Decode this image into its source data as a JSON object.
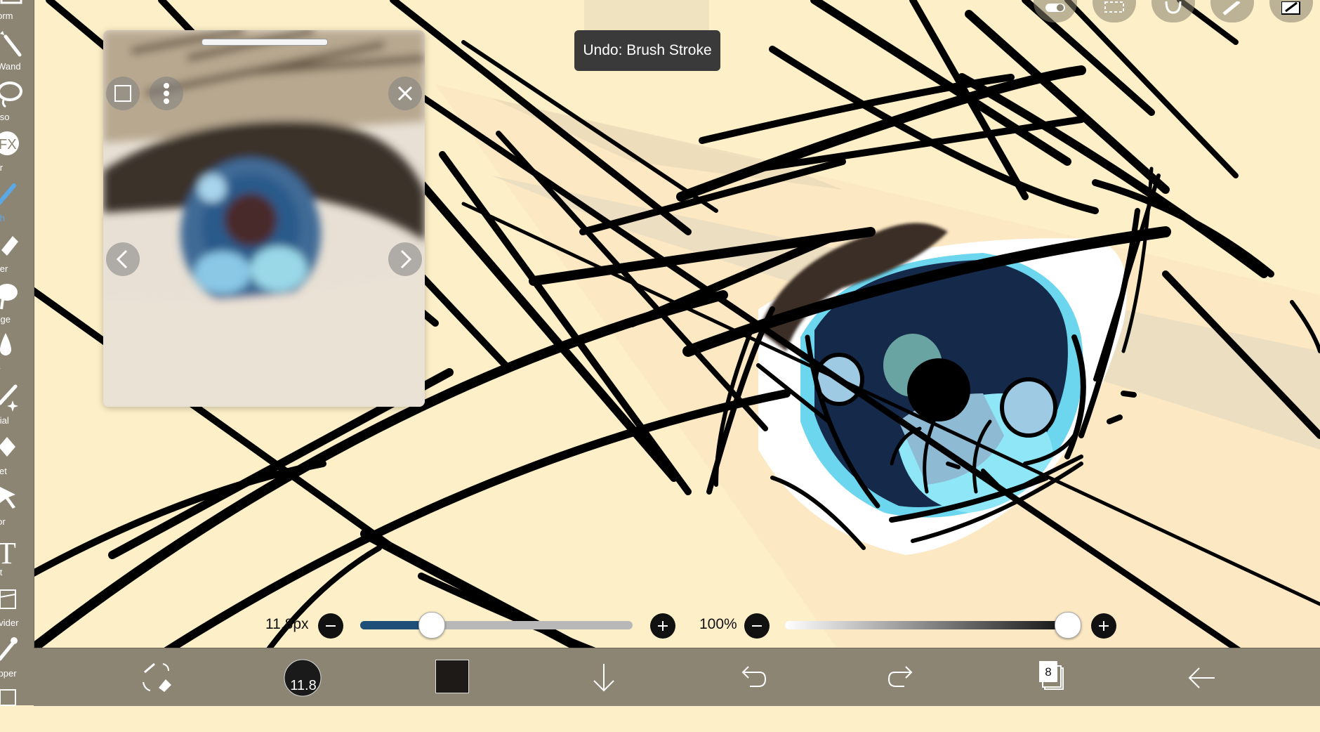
{
  "colors": {
    "toolbar": "#8c8574",
    "accent": "#5aa9e6",
    "canvas": "#fdf0c8",
    "current_color": "#1e1a18"
  },
  "left_toolbar": {
    "items": [
      {
        "label": "sform",
        "icon": "transform-icon",
        "active": false
      },
      {
        "label": "c Wand",
        "icon": "magic-wand-icon",
        "active": false
      },
      {
        "label": "asso",
        "icon": "lasso-icon",
        "active": false
      },
      {
        "label": "lter",
        "icon": "filter-fx-icon",
        "active": false
      },
      {
        "label": "ush",
        "icon": "brush-icon",
        "active": true
      },
      {
        "label": "aser",
        "icon": "eraser-icon",
        "active": false
      },
      {
        "label": "udge",
        "icon": "smudge-icon",
        "active": false
      },
      {
        "label": "lur",
        "icon": "blur-drop-icon",
        "active": false
      },
      {
        "label": "ecial",
        "icon": "special-pen-icon",
        "active": false
      },
      {
        "label": "cket",
        "icon": "bucket-icon",
        "active": false
      },
      {
        "label": "ctor",
        "icon": "vector-pointer-icon",
        "active": false
      },
      {
        "label": "ext",
        "icon": "text-icon",
        "active": false
      },
      {
        "label": " Divider",
        "icon": "frame-divider-icon",
        "active": false
      },
      {
        "label": "ropper",
        "icon": "eyedropper-icon",
        "active": false
      }
    ]
  },
  "top_icons": [
    "toggle-icon",
    "selection-icon",
    "lasso-top-icon",
    "ruler-icon",
    "layer-thumbnail-icon"
  ],
  "toast": {
    "text": "Undo: Brush Stroke"
  },
  "reference_window": {
    "buttons": [
      "expand-icon",
      "more-vertical-icon",
      "close-icon",
      "previous-icon",
      "next-icon"
    ]
  },
  "brush_size": {
    "label": "11.8px",
    "value_fraction": 0.26
  },
  "opacity": {
    "label": "100%",
    "value_fraction": 1.0
  },
  "bottom_toolbar": {
    "brush_size_badge": "11.8",
    "layer_count": "8",
    "items": [
      "brush-eraser-swap-icon",
      "brush-size-icon",
      "color-swatch",
      "save-down-arrow-icon",
      "undo-icon",
      "redo-icon",
      "layers-icon",
      "back-arrow-icon"
    ]
  }
}
